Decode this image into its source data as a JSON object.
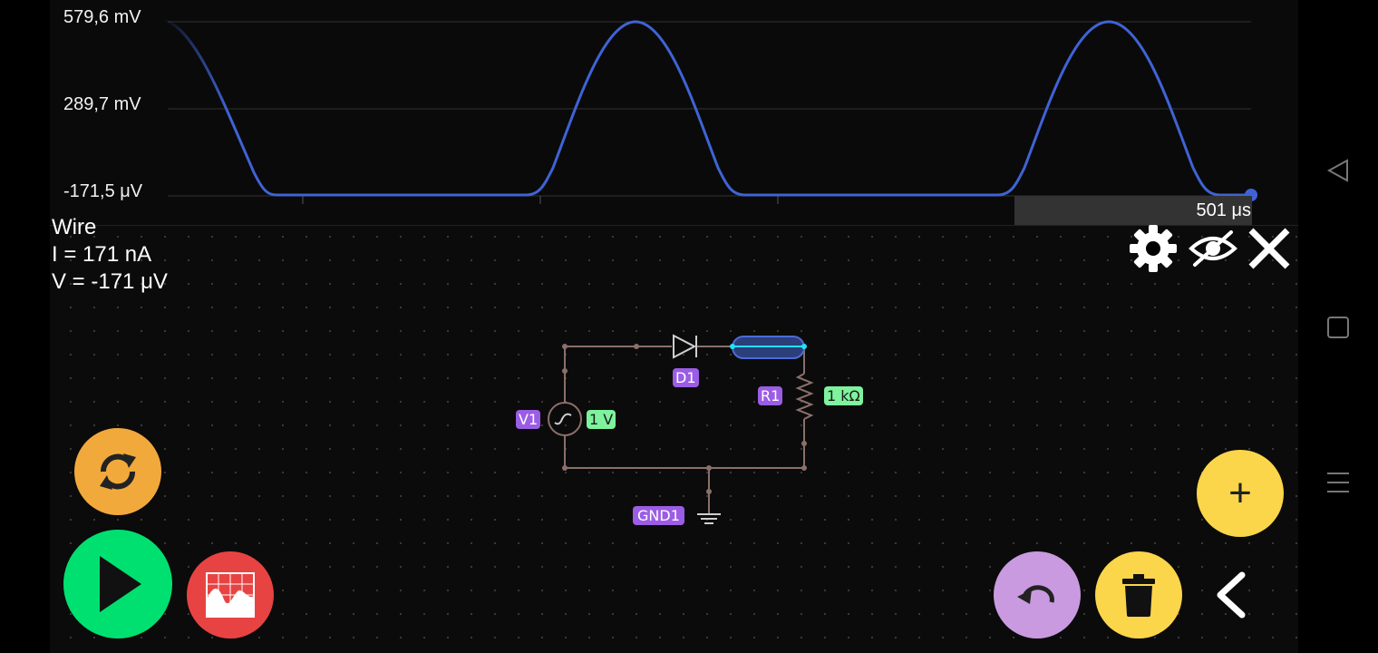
{
  "scope": {
    "y_labels": [
      "579,6 mV",
      "289,7 mV",
      "-171,5 μV"
    ],
    "time_readout": "501 μs",
    "trace_color": "#3f63d6"
  },
  "probe": {
    "element": "Wire",
    "current": "I = 171 nA",
    "voltage": "V = -171 μV"
  },
  "toolbar_icons": [
    "gear-icon",
    "eye-slash-icon",
    "close-icon"
  ],
  "circuit": {
    "source_name": "V1",
    "source_value": "1 V",
    "diode_name": "D1",
    "resistor_name": "R1",
    "resistor_value": "1 kΩ",
    "ground_name": "GND1",
    "wire_color": "#8b6f6a"
  },
  "buttons": {
    "reset": "refresh-icon",
    "play": "play-icon",
    "graph": "graph-icon",
    "add": "+",
    "undo": "undo-icon",
    "delete": "trash-icon",
    "collapse": "chevron-left-icon"
  },
  "colors": {
    "orange": "#f2a93b",
    "green": "#00e070",
    "red": "#e84343",
    "yellow": "#fbd64a",
    "purple": "#c99ae0",
    "component_tag": "#9b5de5",
    "value_tag": "#7ef29d"
  }
}
